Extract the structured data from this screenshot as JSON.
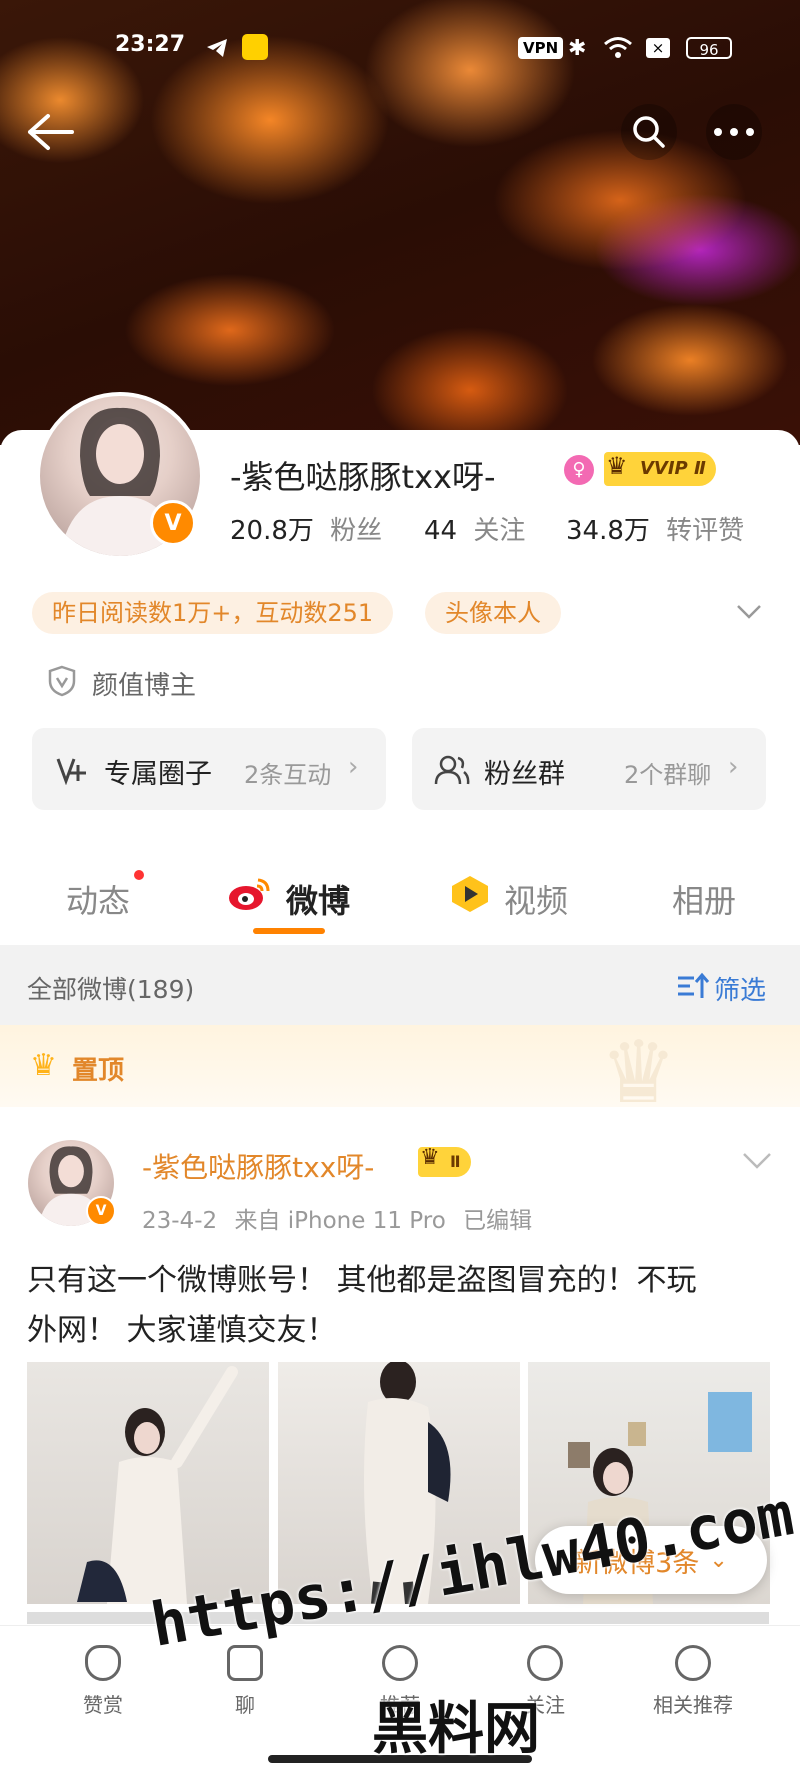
{
  "status_bar": {
    "time": "23:27",
    "vpn": "VPN",
    "battery": "96"
  },
  "profile": {
    "name": "-紫色哒豚豚txx呀-",
    "vip": "VVIP Ⅱ",
    "fans_count": "20.8万",
    "fans_label": "粉丝",
    "follow_count": "44",
    "follow_label": "关注",
    "reposts_count": "34.8万",
    "reposts_label": "转评赞",
    "tags": [
      "昨日阅读数1万+，互动数251",
      "头像本人"
    ],
    "category": "颜值博主"
  },
  "cards": [
    {
      "title": "专属圈子",
      "sub": "2条互动",
      "icon": "circle-icon"
    },
    {
      "title": "粉丝群",
      "sub": "2个群聊",
      "icon": "group-icon"
    }
  ],
  "tabs": [
    {
      "label": "动态"
    },
    {
      "label": "微博"
    },
    {
      "label": "视频"
    },
    {
      "label": "相册"
    }
  ],
  "filter": {
    "label": "全部微博(189)",
    "button": "筛选"
  },
  "pinned": {
    "label": "置顶"
  },
  "post": {
    "author": "-紫色哒豚豚txx呀-",
    "vip": "Ⅱ",
    "date": "23-4-2",
    "source": "来自 iPhone 11 Pro",
    "edited": "已编辑",
    "text_line1": "只有这一个微博账号！ 其他都是盗图冒充的！不玩",
    "text_line2": "外网！ 大家谨慎交友！"
  },
  "new_posts": {
    "label": "新微博3条"
  },
  "bottom_nav": [
    {
      "label": "赞赏",
      "icon": "heart-yuan-icon"
    },
    {
      "label": "聊",
      "icon": "chat-icon"
    },
    {
      "label": "推荐",
      "icon": "recommend-icon"
    },
    {
      "label": "关注",
      "icon": "follow-icon"
    },
    {
      "label": "相关推荐",
      "icon": "related-icon"
    }
  ],
  "watermark": {
    "url": "https://ihlw40.com",
    "text": "黑料网"
  }
}
